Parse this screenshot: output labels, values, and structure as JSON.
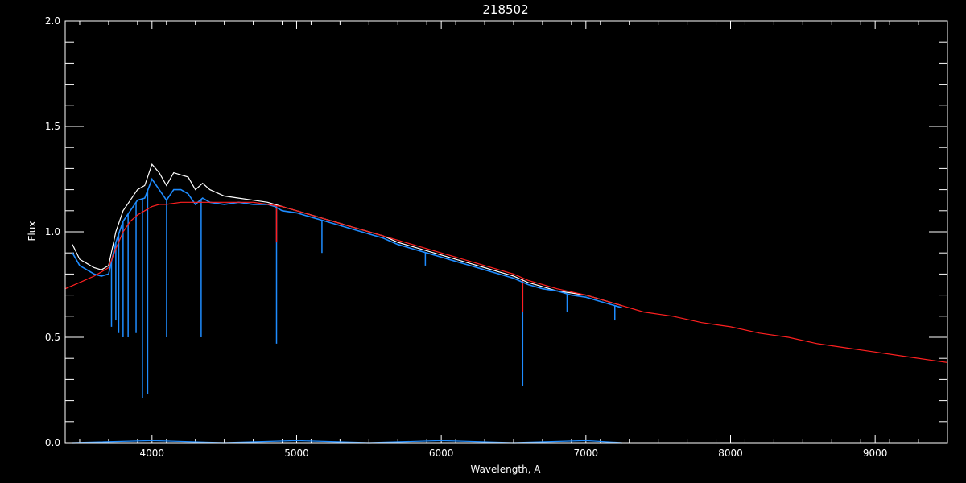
{
  "chart_data": {
    "type": "line",
    "title": "218502",
    "xlabel": "Wavelength, A",
    "ylabel": "Flux",
    "xlim": [
      3400,
      9500
    ],
    "ylim": [
      0.0,
      2.0
    ],
    "x_ticks": [
      {
        "value": 4000,
        "label": "4000"
      },
      {
        "value": 5000,
        "label": "5000"
      },
      {
        "value": 6000,
        "label": "6000"
      },
      {
        "value": 7000,
        "label": "7000"
      },
      {
        "value": 8000,
        "label": "8000"
      },
      {
        "value": 9000,
        "label": "9000"
      }
    ],
    "y_ticks": [
      {
        "value": 0.0,
        "label": "0.0"
      },
      {
        "value": 0.5,
        "label": "0.5"
      },
      {
        "value": 1.0,
        "label": "1.0"
      },
      {
        "value": 1.5,
        "label": "1.5"
      },
      {
        "value": 2.0,
        "label": "2.0"
      }
    ],
    "grid": false,
    "background": "#000000",
    "axis_color": "#ffffff",
    "series": [
      {
        "color": "#ffffff",
        "x": [
          3450,
          3500,
          3550,
          3600,
          3650,
          3700,
          3750,
          3800,
          3850,
          3900,
          3950,
          4000,
          4050,
          4100,
          4150,
          4200,
          4250,
          4300,
          4350,
          4400,
          4500,
          4600,
          4700,
          4800,
          4850,
          4900,
          5000,
          5100,
          5200,
          5300,
          5400,
          5500,
          5600,
          5700,
          5800,
          5900,
          6000,
          6100,
          6200,
          6300,
          6400,
          6500,
          6600,
          6700,
          6800,
          6900,
          7000,
          7100,
          7200,
          7250
        ],
        "y": [
          0.94,
          0.87,
          0.85,
          0.83,
          0.82,
          0.84,
          1.0,
          1.1,
          1.15,
          1.2,
          1.22,
          1.32,
          1.28,
          1.22,
          1.28,
          1.27,
          1.26,
          1.2,
          1.23,
          1.2,
          1.17,
          1.16,
          1.15,
          1.14,
          1.13,
          1.12,
          1.1,
          1.08,
          1.06,
          1.04,
          1.02,
          1.0,
          0.98,
          0.95,
          0.93,
          0.91,
          0.89,
          0.87,
          0.85,
          0.83,
          0.81,
          0.79,
          0.76,
          0.74,
          0.72,
          0.71,
          0.7,
          0.68,
          0.66,
          0.65
        ]
      },
      {
        "color": "#1e8cff",
        "x": [
          3450,
          3500,
          3550,
          3600,
          3650,
          3700,
          3750,
          3800,
          3850,
          3900,
          3950,
          4000,
          4050,
          4100,
          4150,
          4200,
          4250,
          4300,
          4350,
          4400,
          4500,
          4600,
          4700,
          4800,
          4850,
          4900,
          5000,
          5100,
          5200,
          5300,
          5400,
          5500,
          5600,
          5700,
          5800,
          5900,
          6000,
          6100,
          6200,
          6300,
          6400,
          6500,
          6600,
          6700,
          6800,
          6900,
          7000,
          7100,
          7200,
          7250
        ],
        "y": [
          0.9,
          0.84,
          0.82,
          0.8,
          0.79,
          0.8,
          0.95,
          1.05,
          1.1,
          1.15,
          1.16,
          1.25,
          1.2,
          1.15,
          1.2,
          1.2,
          1.18,
          1.13,
          1.16,
          1.14,
          1.13,
          1.14,
          1.13,
          1.13,
          1.12,
          1.1,
          1.09,
          1.07,
          1.05,
          1.03,
          1.01,
          0.99,
          0.97,
          0.94,
          0.92,
          0.9,
          0.88,
          0.86,
          0.84,
          0.82,
          0.8,
          0.78,
          0.75,
          0.73,
          0.72,
          0.7,
          0.69,
          0.67,
          0.65,
          0.64
        ]
      },
      {
        "color": "#ff2020",
        "x": [
          3400,
          3500,
          3600,
          3650,
          3700,
          3750,
          3800,
          3850,
          3900,
          3950,
          4000,
          4050,
          4100,
          4200,
          4300,
          4400,
          4500,
          4600,
          4700,
          4800,
          4900,
          5000,
          5200,
          5400,
          5600,
          5800,
          6000,
          6200,
          6400,
          6500,
          6600,
          6800,
          7000,
          7200,
          7400,
          7600,
          7800,
          8000,
          8200,
          8400,
          8600,
          8800,
          9000,
          9200,
          9400,
          9500
        ],
        "y": [
          0.73,
          0.76,
          0.79,
          0.81,
          0.83,
          0.92,
          1.0,
          1.05,
          1.08,
          1.1,
          1.12,
          1.13,
          1.13,
          1.14,
          1.14,
          1.14,
          1.14,
          1.14,
          1.14,
          1.13,
          1.12,
          1.1,
          1.06,
          1.02,
          0.98,
          0.94,
          0.9,
          0.86,
          0.82,
          0.8,
          0.77,
          0.73,
          0.7,
          0.66,
          0.62,
          0.6,
          0.57,
          0.55,
          0.52,
          0.5,
          0.47,
          0.45,
          0.43,
          0.41,
          0.39,
          0.38
        ]
      },
      {
        "color": "#1e8cff",
        "x": [
          3450,
          4000,
          4500,
          5000,
          5500,
          6000,
          6500,
          7000,
          7250
        ],
        "y": [
          0.0,
          0.01,
          0.0,
          0.01,
          0.0,
          0.01,
          0.0,
          0.01,
          0.0
        ]
      }
    ],
    "absorption_lines": [
      {
        "x": 3720,
        "depth_to": 0.55,
        "color": "#1e8cff"
      },
      {
        "x": 3750,
        "depth_to": 0.58,
        "color": "#1e8cff"
      },
      {
        "x": 3770,
        "depth_to": 0.52,
        "color": "#1e8cff"
      },
      {
        "x": 3800,
        "depth_to": 0.5,
        "color": "#1e8cff"
      },
      {
        "x": 3835,
        "depth_to": 0.5,
        "color": "#1e8cff"
      },
      {
        "x": 3890,
        "depth_to": 0.52,
        "color": "#1e8cff"
      },
      {
        "x": 3934,
        "depth_to": 0.21,
        "color": "#1e8cff"
      },
      {
        "x": 3970,
        "depth_to": 0.23,
        "color": "#1e8cff"
      },
      {
        "x": 4101,
        "depth_to": 0.5,
        "color": "#1e8cff"
      },
      {
        "x": 4340,
        "depth_to": 0.5,
        "color": "#1e8cff"
      },
      {
        "x": 4861,
        "depth_to": 0.47,
        "color": "#1e8cff"
      },
      {
        "x": 5175,
        "depth_to": 0.9,
        "color": "#1e8cff"
      },
      {
        "x": 5890,
        "depth_to": 0.84,
        "color": "#1e8cff"
      },
      {
        "x": 6563,
        "depth_to": 0.27,
        "color": "#1e8cff"
      },
      {
        "x": 6870,
        "depth_to": 0.62,
        "color": "#1e8cff"
      },
      {
        "x": 7200,
        "depth_to": 0.58,
        "color": "#1e8cff"
      },
      {
        "x": 4861,
        "depth_to": 0.95,
        "color": "#ff2020"
      },
      {
        "x": 6563,
        "depth_to": 0.62,
        "color": "#ff2020"
      }
    ]
  }
}
